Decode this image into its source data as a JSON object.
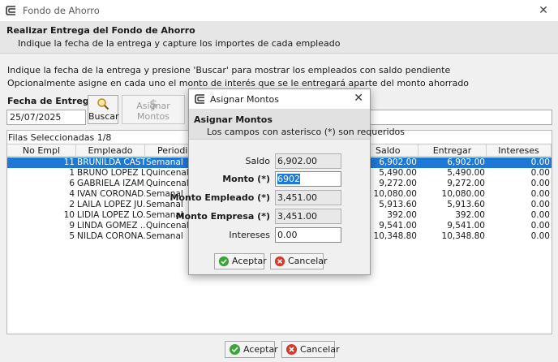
{
  "window": {
    "title": "Fondo de Ahorro",
    "close_glyph": "✕"
  },
  "header": {
    "title": "Realizar Entrega del Fondo de Ahorro",
    "subtitle": "Indique la fecha de la entrega y capture los importes de cada empleado"
  },
  "instructions": {
    "line1": "Indique la fecha de la entrega y presione 'Buscar' para mostrar los empleados con saldo pendiente",
    "line2": "Opcionalmente asigne en cada uno el monto de interés que se le entregará aparte del monto ahorrado"
  },
  "fecha": {
    "label": "Fecha de Entrega",
    "value": "25/07/2025"
  },
  "toolbar": {
    "buscar": "Buscar",
    "asignar": "Asignar Montos"
  },
  "table": {
    "selected_label": "Filas Seleccionadas  1/8",
    "columns": [
      "No Empl",
      "Empleado",
      "Periodicidad",
      "Saldo",
      "Entregar",
      "Intereses"
    ],
    "rows": [
      {
        "no": "11",
        "empleado": "BRUNILDA CAST...",
        "periodo": "Semanal",
        "saldo": "6,902.00",
        "entregar": "6,902.00",
        "intereses": "0.00",
        "selected": true
      },
      {
        "no": "1",
        "empleado": "BRUNO LOPEZ L...",
        "periodo": "Quincenal",
        "saldo": "5,490.00",
        "entregar": "5,490.00",
        "intereses": "0.00"
      },
      {
        "no": "6",
        "empleado": "GABRIELA IZAM...",
        "periodo": "Quincenal",
        "saldo": "9,272.00",
        "entregar": "9,272.00",
        "intereses": "0.00"
      },
      {
        "no": "4",
        "empleado": "IVAN CORONAD...",
        "periodo": "Semanal",
        "saldo": "10,080.00",
        "entregar": "10,080.00",
        "intereses": "0.00"
      },
      {
        "no": "2",
        "empleado": "LAILA LOPEZ JU...",
        "periodo": "Semanal",
        "saldo": "5,913.60",
        "entregar": "5,913.60",
        "intereses": "0.00"
      },
      {
        "no": "10",
        "empleado": "LIDIA LOPEZ LO...",
        "periodo": "Semanal",
        "saldo": "392.00",
        "entregar": "392.00",
        "intereses": "0.00"
      },
      {
        "no": "9",
        "empleado": "LINDA GOMEZ ...",
        "periodo": "Quincenal",
        "saldo": "9,541.00",
        "entregar": "9,541.00",
        "intereses": "0.00"
      },
      {
        "no": "5",
        "empleado": "NILDA CORONA...",
        "periodo": "Semanal",
        "saldo": "10,348.80",
        "entregar": "10,348.80",
        "intereses": "0.00"
      }
    ]
  },
  "footer": {
    "aceptar": "Aceptar",
    "cancelar": "Cancelar"
  },
  "modal": {
    "title": "Asignar Montos",
    "close_glyph": "✕",
    "header_title": "Asignar Montos",
    "header_subtitle": "Los campos con asterisco (*) son requeridos",
    "saldo_label": "Saldo",
    "saldo_value": "6,902.00",
    "monto_label": "Monto (*)",
    "monto_value": "6902",
    "monto_empleado_label": "Monto Empleado (*)",
    "monto_empleado_value": "3,451.00",
    "monto_empresa_label": "Monto Empresa (*)",
    "monto_empresa_value": "3,451.00",
    "intereses_label": "Intereses",
    "intereses_value": "0.00",
    "aceptar": "Aceptar",
    "cancelar": "Cancelar"
  },
  "colors": {
    "selection": "#1e78d6",
    "ok_icon": "#3aa63a",
    "cancel_icon": "#d63a2a"
  },
  "icons": {
    "app": "app-logo-icon",
    "buscar": "magnifier-icon",
    "asignar": "dollar-icon",
    "ok": "check-circle-icon",
    "cancel": "x-circle-icon"
  }
}
